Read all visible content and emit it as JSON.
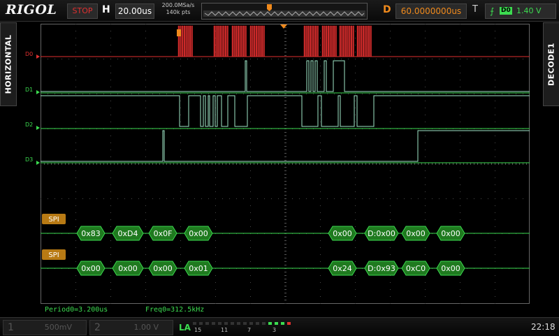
{
  "header": {
    "logo": "RIGOL",
    "run_state": "STOP",
    "h_label": "H",
    "timebase": "20.00us",
    "sample_rate": "200.0MSa/s",
    "memory_depth": "140k pts",
    "d_label": "D",
    "delay": "60.0000000us",
    "t_label": "T",
    "trigger_source": "D0",
    "trigger_level": "1.40 V",
    "trigger_edge_icon": "rising-edge-icon"
  },
  "side_tabs": {
    "left": "HORIZONTAL",
    "right": "DECODE1"
  },
  "digital_channels": [
    {
      "label": "D0",
      "color": "#e03030"
    },
    {
      "label": "D1",
      "color": "#3cdc50"
    },
    {
      "label": "D2",
      "color": "#3cdc50"
    },
    {
      "label": "D3",
      "color": "#3cdc50"
    }
  ],
  "decode_buses": [
    {
      "tag": "SPI",
      "packets": [
        "0x83",
        "0xD4",
        "0x0F",
        "0x00",
        "0x00",
        "D:0x00",
        "0x00",
        "0x00"
      ]
    },
    {
      "tag": "SPI",
      "packets": [
        "0x00",
        "0x00",
        "0x00",
        "0x01",
        "0x24",
        "D:0x93",
        "0xC0",
        "0x00"
      ]
    }
  ],
  "measurements": {
    "period": "Period0=3.200us",
    "freq": "Freq0=312.5kHz"
  },
  "bottom": {
    "ch1_num": "1",
    "ch1_scale": "500mV",
    "ch2_num": "2",
    "ch2_scale": "1.00 V",
    "la_label": "LA",
    "la_groups": [
      "15",
      "11",
      "7",
      "3"
    ],
    "clock": "22:18"
  },
  "colors": {
    "accent_orange": "#f08a1c",
    "digital_green": "#3cdc50",
    "clock_red": "#e03030",
    "packet_fill": "#1f7a1f"
  }
}
